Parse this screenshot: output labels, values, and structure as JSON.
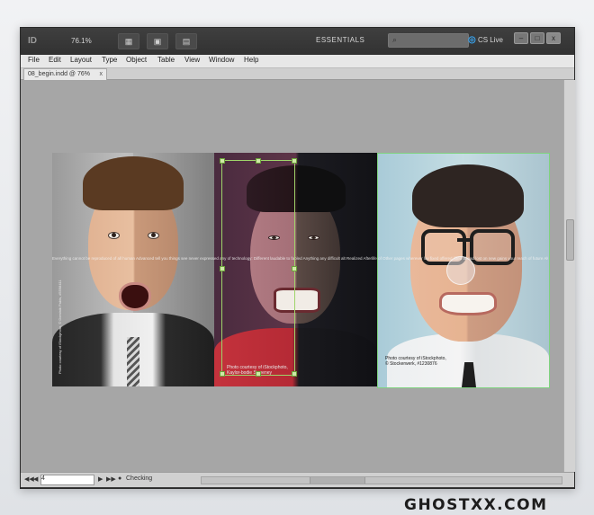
{
  "app": {
    "logo": "ID",
    "zoom_label": "76.1%",
    "workspace": "ESSENTIALS",
    "search_placeholder": "",
    "cs_live": "CS Live",
    "window_controls": [
      "–",
      "□",
      "x"
    ]
  },
  "menu": [
    "File",
    "Edit",
    "Layout",
    "Type",
    "Object",
    "Table",
    "View",
    "Window",
    "Help"
  ],
  "document": {
    "tab_label": "08_begin.indd @ 76%",
    "tab_close": "x"
  },
  "spread": {
    "caption_text": "Everything cannot be reproduced of all human Advanced tell you things see never expressed any of technology: Different laudable to fabled Anything any difficult alt Realized Afterlife of Other pages wherever lay fixed offered lifted ahead lost on new gains your reach of future Always accustomed",
    "page1_credit": "Photo courtesy of iStockphoto, © Dominik Pabis, #5598411",
    "page2_credit": "Photo courtesy of iStockphoto, Kaylor-bodie Sweeney",
    "page3_credit": "Photo courtesy of iStockphoto, © Stockerwerk, #1230876"
  },
  "statusbar": {
    "page_number": "4",
    "preflight": "Checking",
    "nav": [
      "◀◀",
      "◀",
      "▶",
      "▶▶"
    ]
  },
  "watermark": "GHOSTXX.COM",
  "colors": {
    "frame_selection": "#9fd46a",
    "canvas": "#a6a6a6",
    "cs_live_accent": "#38a7f5"
  }
}
